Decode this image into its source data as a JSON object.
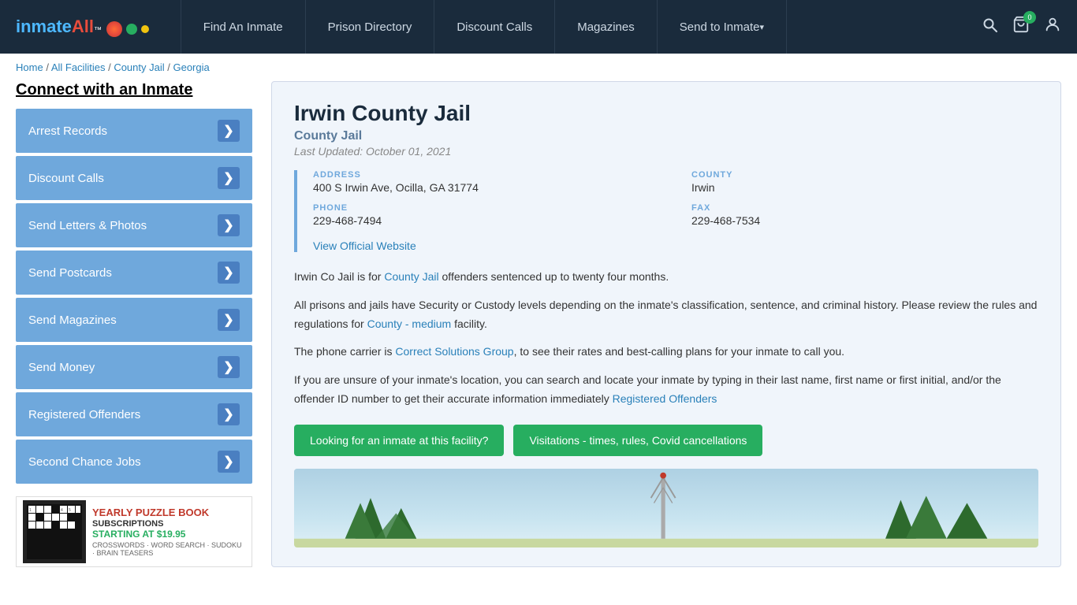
{
  "site": {
    "logo_text": "inmate",
    "logo_highlight": "All",
    "logo_badge": "™"
  },
  "navbar": {
    "links": [
      {
        "id": "find-inmate",
        "label": "Find An Inmate",
        "hasArrow": false
      },
      {
        "id": "prison-directory",
        "label": "Prison Directory",
        "hasArrow": false
      },
      {
        "id": "discount-calls",
        "label": "Discount Calls",
        "hasArrow": false
      },
      {
        "id": "magazines",
        "label": "Magazines",
        "hasArrow": false
      },
      {
        "id": "send-to-inmate",
        "label": "Send to Inmate",
        "hasArrow": true
      }
    ],
    "cart_count": "0",
    "icons": {
      "search": "🔍",
      "cart": "🛒",
      "user": "👤"
    }
  },
  "breadcrumb": {
    "items": [
      "Home",
      "All Facilities",
      "County Jail",
      "Georgia"
    ],
    "separator": " / "
  },
  "sidebar": {
    "title": "Connect with an Inmate",
    "menu_items": [
      {
        "id": "arrest-records",
        "label": "Arrest Records"
      },
      {
        "id": "discount-calls",
        "label": "Discount Calls"
      },
      {
        "id": "send-letters-photos",
        "label": "Send Letters & Photos"
      },
      {
        "id": "send-postcards",
        "label": "Send Postcards"
      },
      {
        "id": "send-magazines",
        "label": "Send Magazines"
      },
      {
        "id": "send-money",
        "label": "Send Money"
      },
      {
        "id": "registered-offenders",
        "label": "Registered Offenders"
      },
      {
        "id": "second-chance-jobs",
        "label": "Second Chance Jobs"
      }
    ],
    "arrow_label": "❯",
    "ad": {
      "title": "YEARLY PUZZLE BOOK",
      "subtitle": "SUBSCRIPTIONS",
      "price": "STARTING AT $19.95",
      "desc": "CROSSWORDS · WORD SEARCH · SUDOKU · BRAIN TEASERS",
      "icon": "🧩"
    }
  },
  "facility": {
    "name": "Irwin County Jail",
    "type": "County Jail",
    "last_updated": "Last Updated: October 01, 2021",
    "address_label": "ADDRESS",
    "address_value": "400 S Irwin Ave, Ocilla, GA 31774",
    "county_label": "COUNTY",
    "county_value": "Irwin",
    "phone_label": "PHONE",
    "phone_value": "229-468-7494",
    "fax_label": "FAX",
    "fax_value": "229-468-7534",
    "website_label": "View Official Website",
    "website_url": "#",
    "description": {
      "para1": "Irwin Co Jail is for County Jail offenders sentenced up to twenty four months.",
      "para1_link_text": "County Jail",
      "para2": "All prisons and jails have Security or Custody levels depending on the inmate's classification, sentence, and criminal history. Please review the rules and regulations for County - medium facility.",
      "para2_link_text": "County - medium",
      "para3": "The phone carrier is Correct Solutions Group, to see their rates and best-calling plans for your inmate to call you.",
      "para3_link_text": "Correct Solutions Group",
      "para4": "If you are unsure of your inmate's location, you can search and locate your inmate by typing in their last name, first name or first initial, and/or the offender ID number to get their accurate information immediately Registered Offenders",
      "para4_link_text": "Registered Offenders"
    }
  },
  "buttons": {
    "inmate_search": "Looking for an inmate at this facility?",
    "visitations": "Visitations - times, rules, Covid cancellations"
  }
}
